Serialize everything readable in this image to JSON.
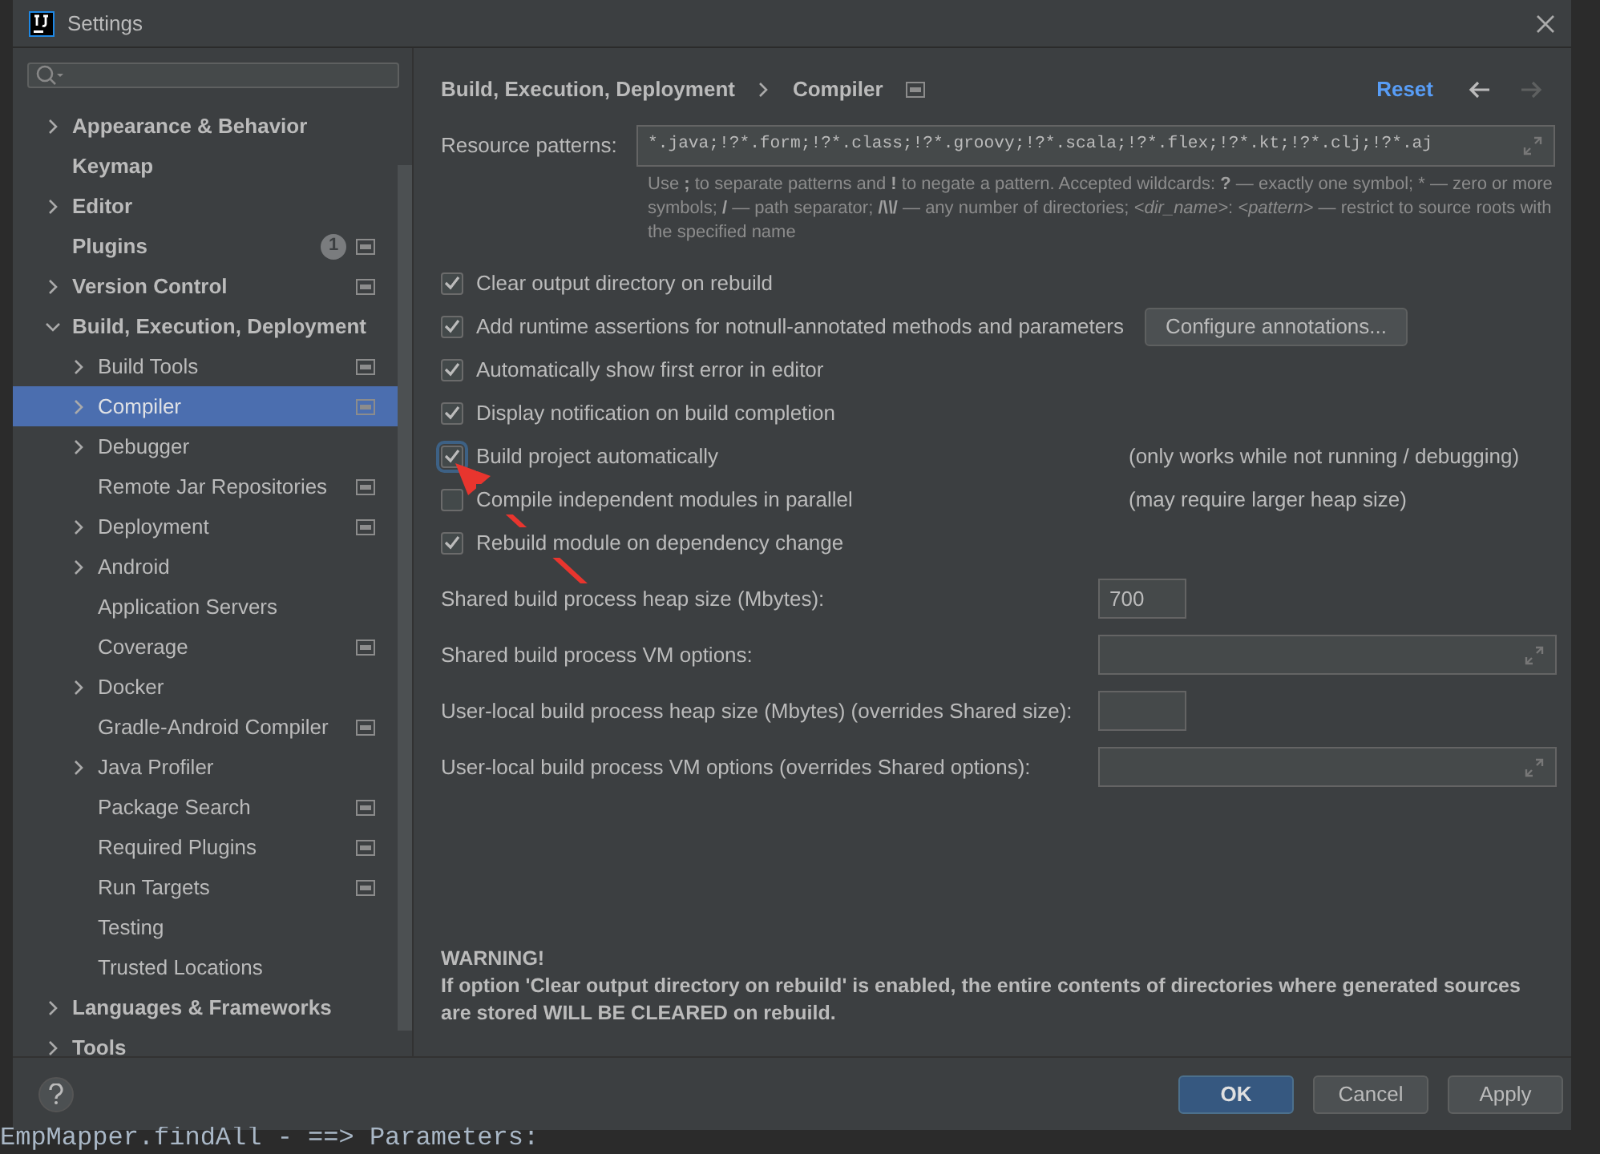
{
  "window": {
    "title": "Settings"
  },
  "sidebar": {
    "items": [
      {
        "label": "Appearance & Behavior",
        "expandable": true,
        "expanded": false,
        "selected": false,
        "project_scope": false
      },
      {
        "label": "Keymap",
        "expandable": false,
        "selected": false,
        "project_scope": false
      },
      {
        "label": "Editor",
        "expandable": true,
        "expanded": false,
        "selected": false,
        "project_scope": false
      },
      {
        "label": "Plugins",
        "expandable": false,
        "selected": false,
        "project_scope": true,
        "badge": "1"
      },
      {
        "label": "Version Control",
        "expandable": true,
        "expanded": false,
        "selected": false,
        "project_scope": true
      },
      {
        "label": "Build, Execution, Deployment",
        "expandable": true,
        "expanded": true,
        "selected": false,
        "project_scope": false,
        "children": [
          {
            "label": "Build Tools",
            "expandable": true,
            "expanded": false,
            "selected": false,
            "project_scope": true
          },
          {
            "label": "Compiler",
            "expandable": true,
            "expanded": false,
            "selected": true,
            "project_scope": true
          },
          {
            "label": "Debugger",
            "expandable": true,
            "expanded": false,
            "selected": false,
            "project_scope": false
          },
          {
            "label": "Remote Jar Repositories",
            "expandable": false,
            "selected": false,
            "project_scope": true
          },
          {
            "label": "Deployment",
            "expandable": true,
            "expanded": false,
            "selected": false,
            "project_scope": true
          },
          {
            "label": "Android",
            "expandable": true,
            "expanded": false,
            "selected": false,
            "project_scope": false
          },
          {
            "label": "Application Servers",
            "expandable": false,
            "selected": false,
            "project_scope": false
          },
          {
            "label": "Coverage",
            "expandable": false,
            "selected": false,
            "project_scope": true
          },
          {
            "label": "Docker",
            "expandable": true,
            "expanded": false,
            "selected": false,
            "project_scope": false
          },
          {
            "label": "Gradle-Android Compiler",
            "expandable": false,
            "selected": false,
            "project_scope": true
          },
          {
            "label": "Java Profiler",
            "expandable": true,
            "expanded": false,
            "selected": false,
            "project_scope": false
          },
          {
            "label": "Package Search",
            "expandable": false,
            "selected": false,
            "project_scope": true
          },
          {
            "label": "Required Plugins",
            "expandable": false,
            "selected": false,
            "project_scope": true
          },
          {
            "label": "Run Targets",
            "expandable": false,
            "selected": false,
            "project_scope": true
          },
          {
            "label": "Testing",
            "expandable": false,
            "selected": false,
            "project_scope": false
          },
          {
            "label": "Trusted Locations",
            "expandable": false,
            "selected": false,
            "project_scope": false
          }
        ]
      },
      {
        "label": "Languages & Frameworks",
        "expandable": true,
        "expanded": false,
        "selected": false,
        "project_scope": false
      },
      {
        "label": "Tools",
        "expandable": true,
        "expanded": false,
        "selected": false,
        "project_scope": false
      }
    ]
  },
  "header": {
    "breadcrumb": [
      "Build, Execution, Deployment",
      "Compiler"
    ],
    "project_scope": true,
    "reset": "Reset",
    "back_enabled": true,
    "forward_enabled": false
  },
  "resource_patterns": {
    "label": "Resource patterns:",
    "value": "*.java;!?*.form;!?*.class;!?*.groovy;!?*.scala;!?*.flex;!?*.kt;!?*.clj;!?*.aj",
    "help": "Use **;** to separate patterns and **!** to negate a pattern. Accepted wildcards: **?** — exactly one symbol; * — zero or more symbols; **/** — path separator; **/\\*\\*/** — any number of directories; *<dir_name>*: *<pattern>* — restrict to source roots with the specified name"
  },
  "options": [
    {
      "label": "Clear output directory on rebuild",
      "checked": true,
      "focused": false
    },
    {
      "label": "Add runtime assertions for notnull-annotated methods and parameters",
      "checked": true,
      "focused": false,
      "button": "Configure annotations..."
    },
    {
      "label": "Automatically show first error in editor",
      "checked": true,
      "focused": false
    },
    {
      "label": "Display notification on build completion",
      "checked": true,
      "focused": false
    },
    {
      "label": "Build project automatically",
      "checked": true,
      "focused": true,
      "note": "(only works while not running / debugging)"
    },
    {
      "label": "Compile independent modules in parallel",
      "checked": false,
      "focused": false,
      "note": "(may require larger heap size)"
    },
    {
      "label": "Rebuild module on dependency change",
      "checked": true,
      "focused": false
    }
  ],
  "fields": [
    {
      "label": "Shared build process heap size (Mbytes):",
      "kind": "short",
      "value": "700"
    },
    {
      "label": "Shared build process VM options:",
      "kind": "expandable"
    },
    {
      "label": "User-local build process heap size (Mbytes) (overrides Shared size):",
      "kind": "short"
    },
    {
      "label": "User-local build process VM options (overrides Shared options):",
      "kind": "expandable"
    }
  ],
  "warning": {
    "title": "WARNING!",
    "text": "If option 'Clear output directory on rebuild' is enabled, the entire contents of directories where generated sources are stored WILL BE CLEARED on rebuild."
  },
  "buttons": [
    {
      "label": "OK",
      "default": true
    },
    {
      "label": "Cancel",
      "default": false
    },
    {
      "label": "Apply",
      "default": false
    }
  ],
  "background_code": "EmpMapper.findAll - ==> Parameters:"
}
